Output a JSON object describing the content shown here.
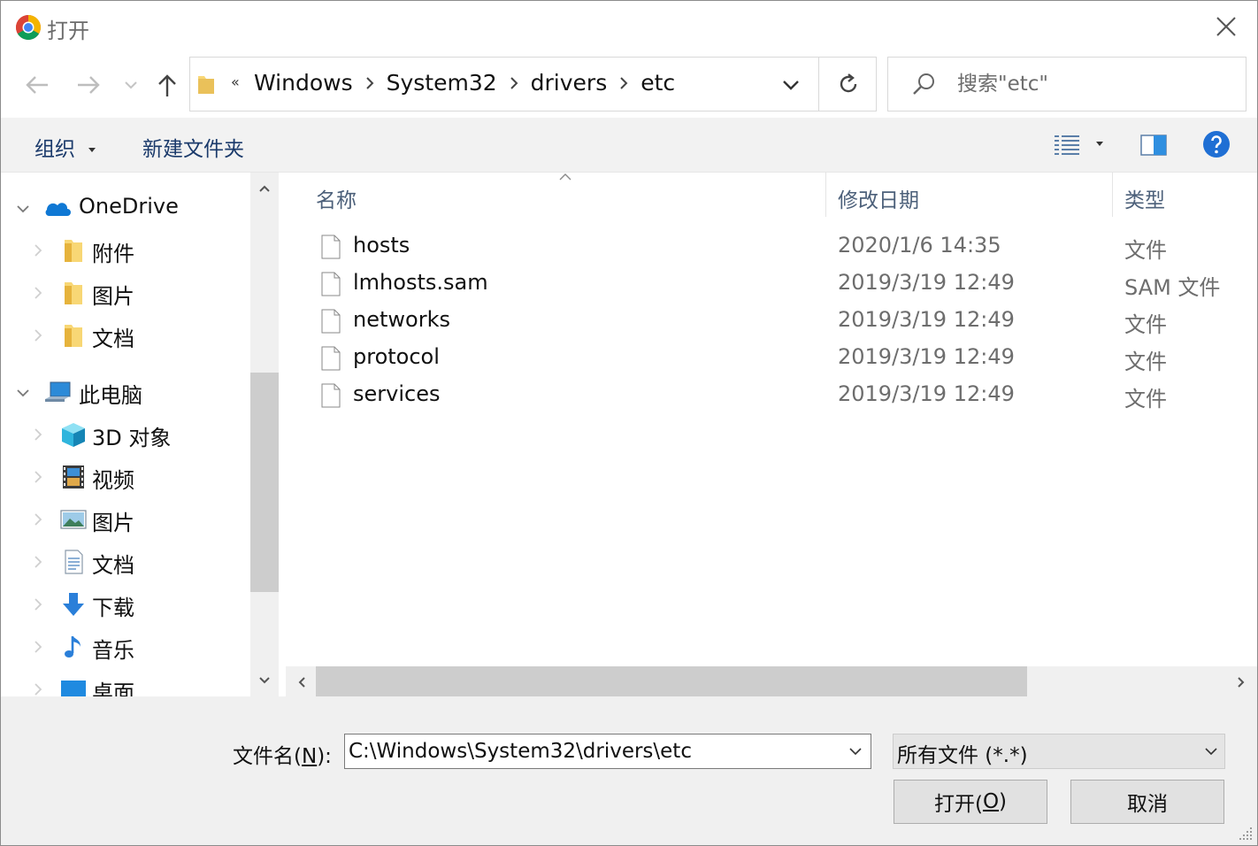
{
  "window": {
    "title": "打开",
    "app_icon": "chrome-icon",
    "close_icon": "close-icon"
  },
  "nav": {
    "back_icon": "arrow-left-icon",
    "forward_icon": "arrow-right-icon",
    "recent_icon": "chevron-down-icon",
    "up_icon": "arrow-up-icon",
    "overflow": "«",
    "breadcrumbs": [
      "Windows",
      "System32",
      "drivers",
      "etc"
    ],
    "refresh_icon": "refresh-icon",
    "search_placeholder": "搜索\"etc\"",
    "search_icon": "search-icon"
  },
  "toolbar": {
    "organize_label": "组织",
    "new_folder_label": "新建文件夹",
    "view_icon": "details-view-icon",
    "preview_icon": "preview-pane-icon",
    "help_icon": "help-icon"
  },
  "sidebar": {
    "items": [
      {
        "label": "OneDrive",
        "icon": "onedrive-icon",
        "level": 0,
        "expanded": true
      },
      {
        "label": "附件",
        "icon": "folder-icon",
        "level": 1
      },
      {
        "label": "图片",
        "icon": "folder-icon",
        "level": 1
      },
      {
        "label": "文档",
        "icon": "folder-icon",
        "level": 1
      },
      {
        "label": "此电脑",
        "icon": "computer-icon",
        "level": 0,
        "expanded": true
      },
      {
        "label": "3D 对象",
        "icon": "3d-objects-icon",
        "level": 1
      },
      {
        "label": "视频",
        "icon": "video-icon",
        "level": 1
      },
      {
        "label": "图片",
        "icon": "pictures-icon",
        "level": 1
      },
      {
        "label": "文档",
        "icon": "documents-icon",
        "level": 1
      },
      {
        "label": "下载",
        "icon": "download-icon",
        "level": 1
      },
      {
        "label": "音乐",
        "icon": "music-icon",
        "level": 1
      },
      {
        "label": "桌面",
        "icon": "desktop-icon",
        "level": 1
      }
    ]
  },
  "filelist": {
    "columns": [
      "名称",
      "修改日期",
      "类型"
    ],
    "files": [
      {
        "name": "hosts",
        "modified": "2020/1/6 14:35",
        "type": "文件"
      },
      {
        "name": "lmhosts.sam",
        "modified": "2019/3/19 12:49",
        "type": "SAM 文件"
      },
      {
        "name": "networks",
        "modified": "2019/3/19 12:49",
        "type": "文件"
      },
      {
        "name": "protocol",
        "modified": "2019/3/19 12:49",
        "type": "文件"
      },
      {
        "name": "services",
        "modified": "2019/3/19 12:49",
        "type": "文件"
      }
    ]
  },
  "footer": {
    "filename_label_pre": "文件名(",
    "filename_label_key": "N",
    "filename_label_post": "):",
    "filename_value": "C:\\Windows\\System32\\drivers\\etc",
    "filetype_value": "所有文件 (*.*)",
    "open_pre": "打开(",
    "open_key": "O",
    "open_post": ")",
    "cancel_label": "取消"
  },
  "colors": {
    "toolbar_bg": "#f2f2f2",
    "link_blue": "#1b3a6b",
    "header_text": "#4c607a",
    "secondary_text": "#6d6d6d",
    "button_bg": "#e1e1e1",
    "scrollbar_thumb": "#cdcdcd"
  }
}
